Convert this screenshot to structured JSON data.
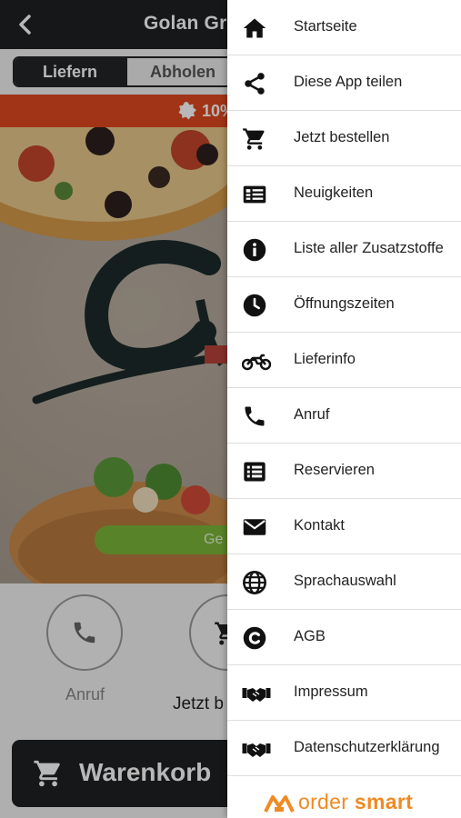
{
  "header": {
    "title": "Golan Grill",
    "back_icon": "chevron-left-icon"
  },
  "order_mode": {
    "options": [
      "Liefern",
      "Abholen"
    ],
    "selected": "Liefern"
  },
  "promo": {
    "text": "10%",
    "icon": "badge-icon"
  },
  "hero": {
    "button_text": "Ge"
  },
  "actions": [
    {
      "label": "Anruf",
      "icon": "phone-icon"
    },
    {
      "label": "Jetzt b",
      "icon": "cart-icon"
    }
  ],
  "cart": {
    "label": "Warenkorb",
    "icon": "cart-icon"
  },
  "menu": {
    "items": [
      {
        "label": "Startseite",
        "icon": "home-icon"
      },
      {
        "label": "Diese App teilen",
        "icon": "share-icon"
      },
      {
        "label": "Jetzt bestellen",
        "icon": "cart-icon"
      },
      {
        "label": "Neuigkeiten",
        "icon": "news-icon"
      },
      {
        "label": "Liste aller Zusatzstoffe",
        "icon": "info-icon"
      },
      {
        "label": "Öffnungszeiten",
        "icon": "clock-icon"
      },
      {
        "label": "Lieferinfo",
        "icon": "motorcycle-icon"
      },
      {
        "label": "Anruf",
        "icon": "phone-icon"
      },
      {
        "label": "Reservieren",
        "icon": "list-icon"
      },
      {
        "label": "Kontakt",
        "icon": "envelope-icon"
      },
      {
        "label": "Sprachauswahl",
        "icon": "globe-icon"
      },
      {
        "label": "AGB",
        "icon": "copyright-icon"
      },
      {
        "label": "Impressum",
        "icon": "handshake-icon"
      },
      {
        "label": "Datenschutzerklärung",
        "icon": "handshake-icon"
      }
    ]
  },
  "brand": {
    "name_part1": "order",
    "name_part2": "smart"
  },
  "colors": {
    "accent": "#e0491f",
    "dark": "#1f2123",
    "green": "#7cb63a",
    "brand": "#f08a23"
  }
}
